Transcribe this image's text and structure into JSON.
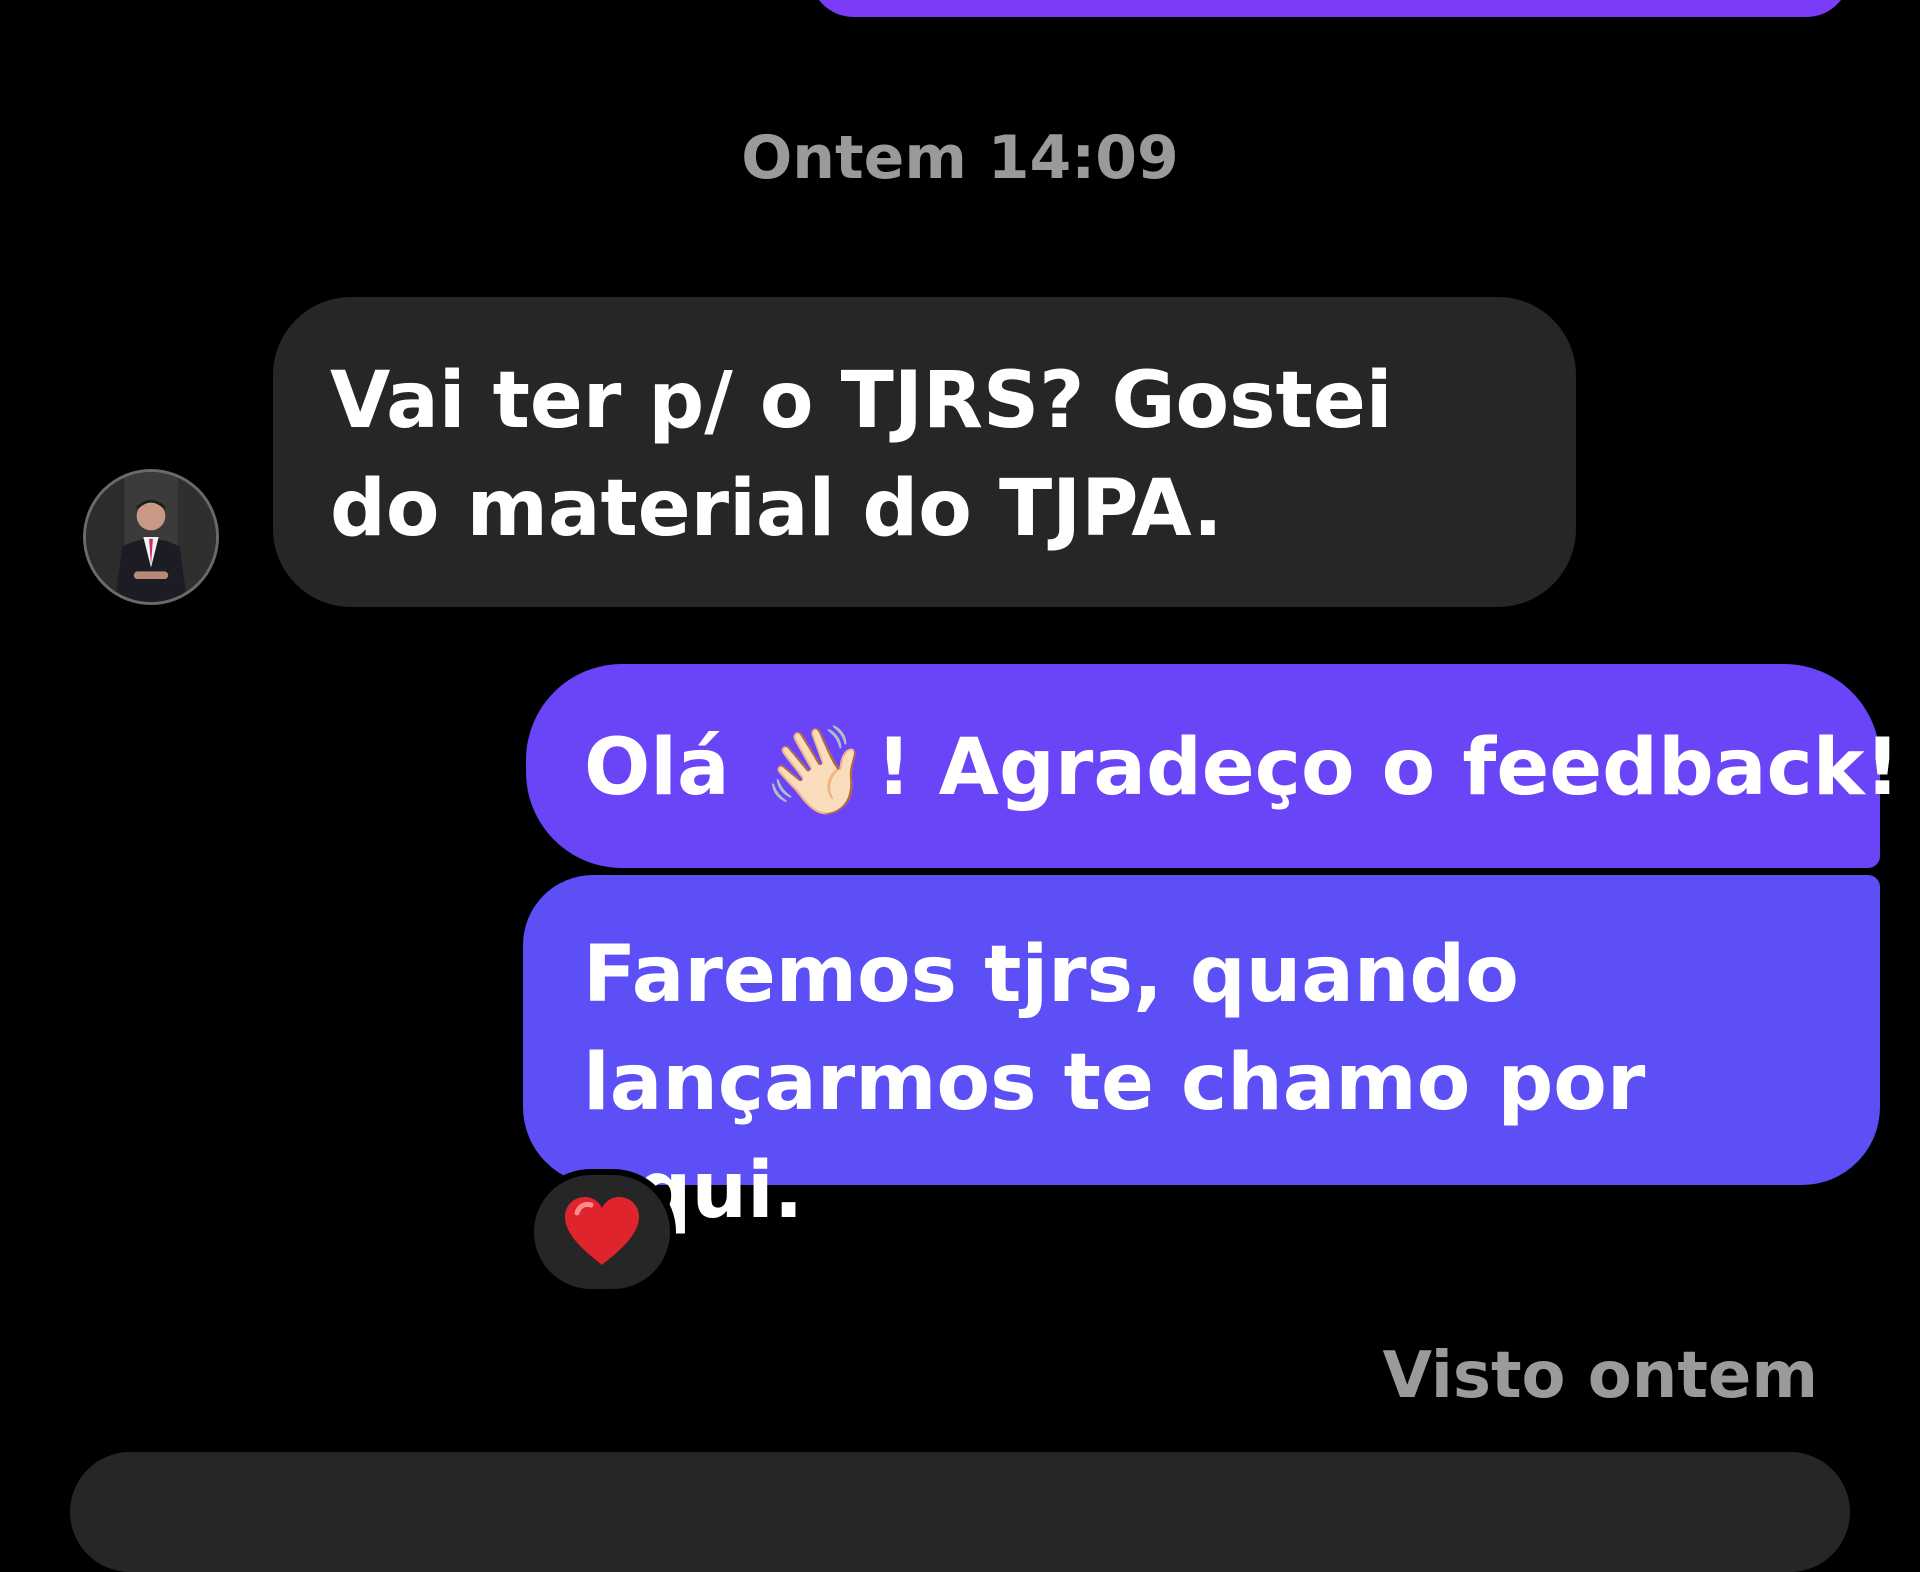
{
  "colors": {
    "background": "#000000",
    "incoming_bubble": "#262626",
    "outgoing_bubble_top": "#6a44f7",
    "outgoing_bubble_bottom": "#5c4ff6",
    "previous_bubble": "#7a3cf6",
    "meta_text": "#9a9a9a"
  },
  "thread": {
    "timestamp": "Ontem 14:09",
    "messages": [
      {
        "direction": "incoming",
        "text": "Vai ter p/ o TJRS? Gostei do material do TJPA."
      },
      {
        "direction": "outgoing",
        "text_before_emoji": "Olá ",
        "emoji": "👋🏻",
        "text_after_emoji": "! Agradeço o feedback!"
      },
      {
        "direction": "outgoing",
        "text": "Faremos tjrs, quando lançarmos te chamo por aqui.",
        "reaction": "heart-icon"
      }
    ],
    "seen_status": "Visto ontem"
  },
  "icons": {
    "avatar": "contact-avatar",
    "reaction": "heart-icon"
  }
}
